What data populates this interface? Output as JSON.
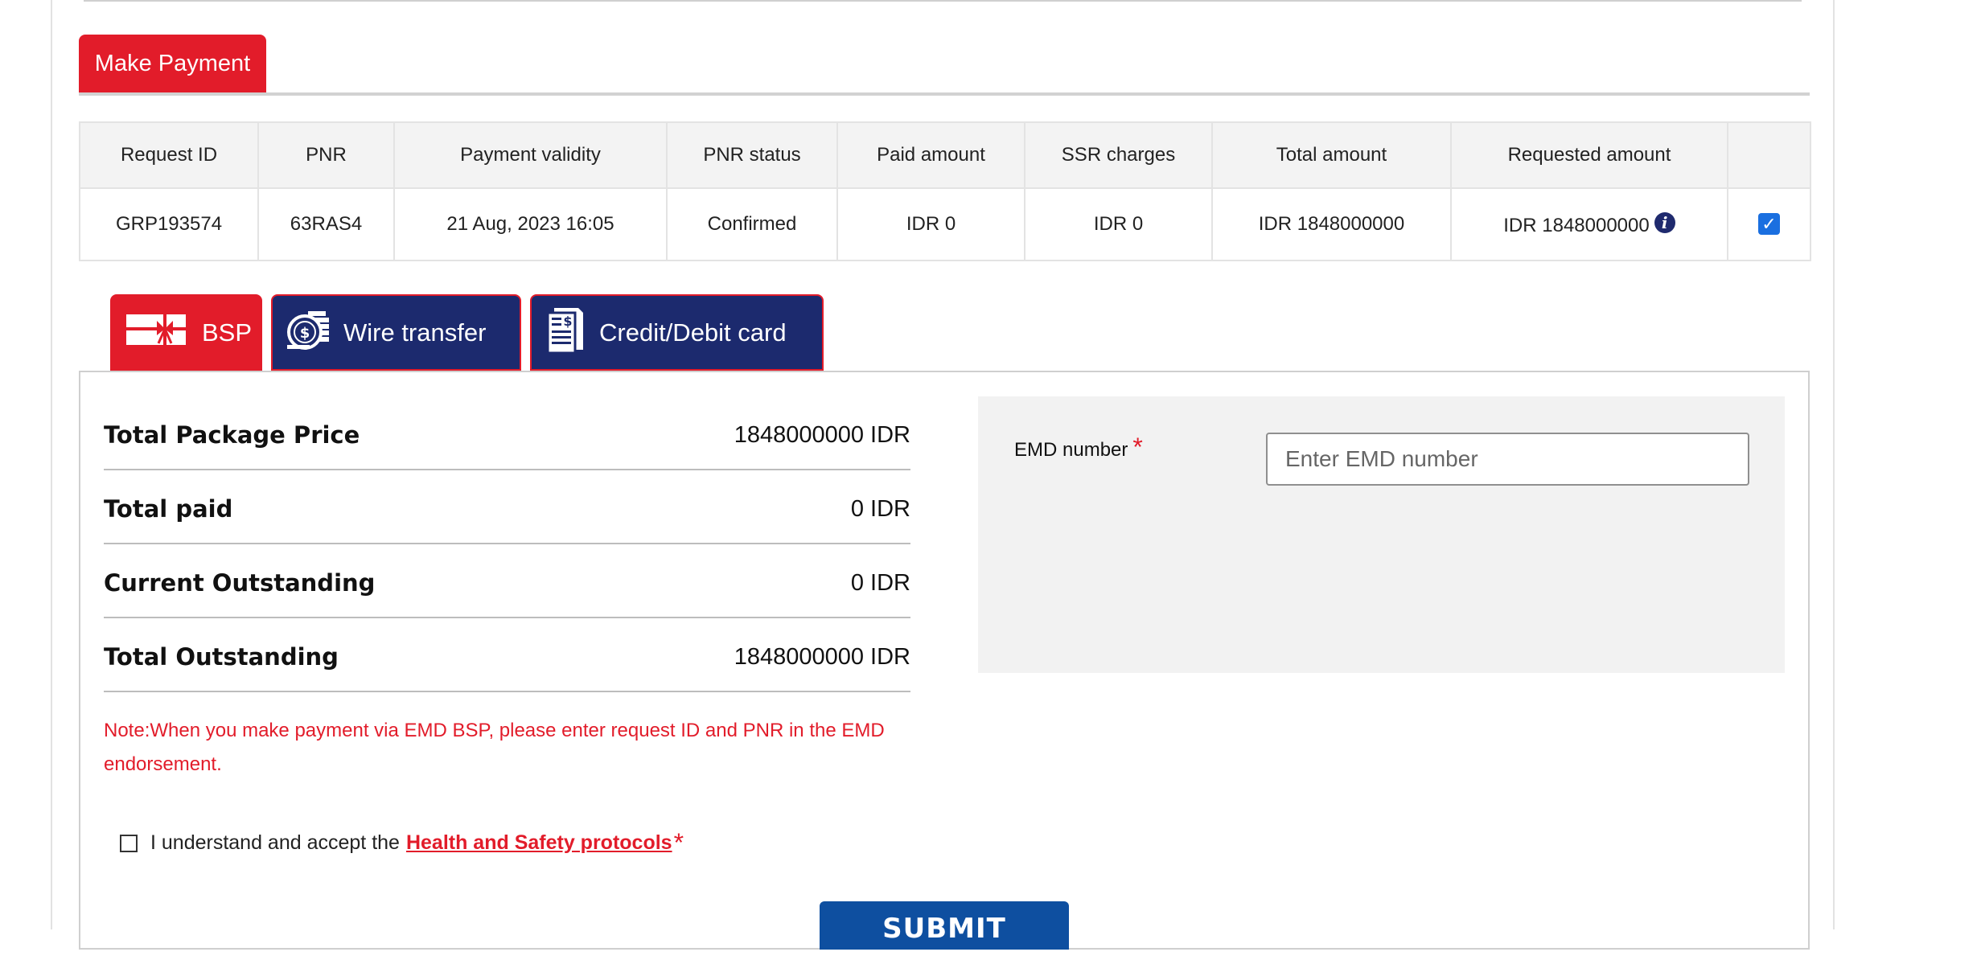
{
  "header": {
    "make_payment_tab": "Make Payment"
  },
  "request_table": {
    "columns": [
      "Request ID",
      "PNR",
      "Payment validity",
      "PNR status",
      "Paid amount",
      "SSR charges",
      "Total amount",
      "Requested amount"
    ],
    "row": {
      "request_id": "GRP193574",
      "pnr": "63RAS4",
      "payment_validity": "21 Aug, 2023 16:05",
      "pnr_status": "Confirmed",
      "paid_amount": "IDR 0",
      "ssr_charges": "IDR 0",
      "total_amount": "IDR 1848000000",
      "requested_amount": "IDR 1848000000",
      "info_icon": "i",
      "selected": true,
      "check_glyph": "✓"
    }
  },
  "payment_tabs": [
    {
      "label": "BSP",
      "icon": "gift-icon",
      "active": true
    },
    {
      "label": "Wire transfer",
      "icon": "coins-icon",
      "active": false
    },
    {
      "label": "Credit/Debit card",
      "icon": "invoice-icon",
      "active": false
    }
  ],
  "summary": [
    {
      "label": "Total Package Price",
      "value": "1848000000 IDR"
    },
    {
      "label": "Total paid",
      "value": "0 IDR"
    },
    {
      "label": "Current Outstanding",
      "value": "0 IDR"
    },
    {
      "label": "Total Outstanding",
      "value": "1848000000 IDR"
    }
  ],
  "note": "Note:When you make payment via EMD BSP, please enter request ID and PNR in the EMD endorsement.",
  "emd": {
    "label": "EMD number",
    "required_mark": "*",
    "placeholder": "Enter EMD number",
    "value": ""
  },
  "agreement": {
    "prefix": "I understand and accept the",
    "link": "Health and Safety protocols",
    "required_mark": "*",
    "checked": false
  },
  "submit_label": "SUBMIT",
  "colors": {
    "brand_red": "#e21c2a",
    "navy": "#1c2a6e",
    "submit_blue": "#0e4fa0"
  }
}
